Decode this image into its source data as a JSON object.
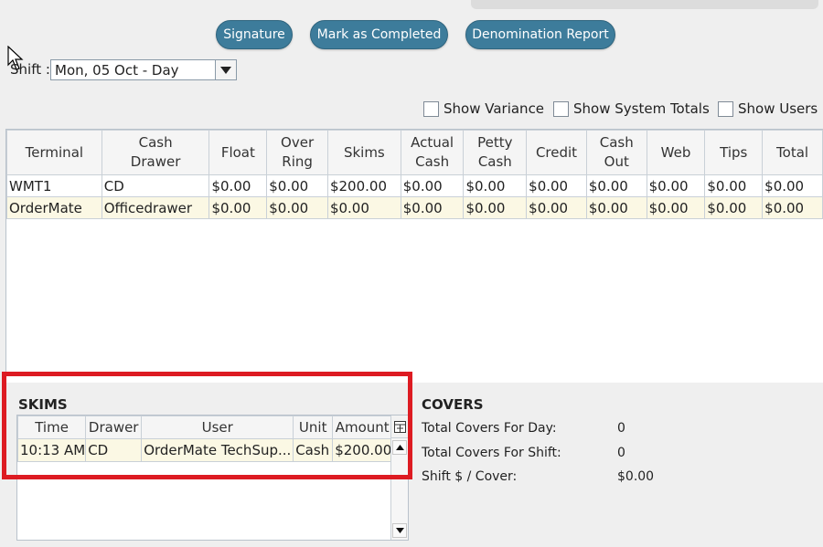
{
  "toolbar": {
    "signature_label": "Signature",
    "mark_completed_label": "Mark as Completed",
    "denomination_label": "Denomination Report"
  },
  "shift": {
    "label": "Shift :",
    "selected": "Mon, 05 Oct - Day"
  },
  "options": {
    "show_variance": "Show Variance",
    "show_system_totals": "Show System Totals",
    "show_users": "Show Users"
  },
  "main_table": {
    "headers": {
      "terminal": "Terminal",
      "cash_drawer_1": "Cash",
      "cash_drawer_2": "Drawer",
      "float": "Float",
      "over_ring_1": "Over",
      "over_ring_2": "Ring",
      "skims": "Skims",
      "actual_cash_1": "Actual",
      "actual_cash_2": "Cash",
      "petty_cash_1": "Petty",
      "petty_cash_2": "Cash",
      "credit": "Credit",
      "cash_out_1": "Cash",
      "cash_out_2": "Out",
      "web": "Web",
      "tips": "Tips",
      "total": "Total"
    },
    "rows": [
      {
        "terminal": "WMT1",
        "drawer": "CD",
        "float": "$0.00",
        "over_ring": "$0.00",
        "skims": "$200.00",
        "actual_cash": "$0.00",
        "petty_cash": "$0.00",
        "credit": "$0.00",
        "cash_out": "$0.00",
        "web": "$0.00",
        "tips": "$0.00",
        "total": "$0.00"
      },
      {
        "terminal": "OrderMate",
        "drawer": "Officedrawer",
        "float": "$0.00",
        "over_ring": "$0.00",
        "skims": "$0.00",
        "actual_cash": "$0.00",
        "petty_cash": "$0.00",
        "credit": "$0.00",
        "cash_out": "$0.00",
        "web": "$0.00",
        "tips": "$0.00",
        "total": "$0.00"
      }
    ]
  },
  "skims": {
    "title": "SKIMS",
    "headers": {
      "time": "Time",
      "drawer": "Drawer",
      "user": "User",
      "unit": "Unit",
      "amount": "Amount"
    },
    "rows": [
      {
        "time": "10:13 AM",
        "drawer": "CD",
        "user": "OrderMate TechSup...",
        "unit": "Cash",
        "amount": "$200.00"
      }
    ]
  },
  "covers": {
    "title": "COVERS",
    "day_label": "Total Covers For Day:",
    "day_value": "0",
    "shift_label": "Total Covers For Shift:",
    "shift_value": "0",
    "per_cover_label": "Shift $ / Cover:",
    "per_cover_value": "$0.00"
  },
  "colors": {
    "button_bg": "#3d7c9b",
    "alt_row": "#fbf8e4",
    "highlight": "#dd1b22"
  }
}
